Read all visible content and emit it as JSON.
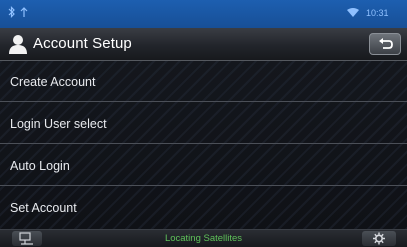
{
  "status_bar": {
    "time": "10:31",
    "background_color": "#1d5fb0",
    "icons": [
      "bluetooth-icon",
      "wifi-icon"
    ]
  },
  "title_bar": {
    "title": "Account Setup",
    "icon": "user-icon",
    "back_icon": "return-arrow-icon"
  },
  "menu": {
    "items": [
      {
        "label": "Create Account"
      },
      {
        "label": "Login User select"
      },
      {
        "label": "Auto Login"
      },
      {
        "label": "Set Account"
      }
    ]
  },
  "bottom_bar": {
    "status_text": "Locating Satellites",
    "status_color": "#5fc15a",
    "left_icon": "navigation-menu-icon",
    "right_icon": "settings-gear-icon"
  }
}
